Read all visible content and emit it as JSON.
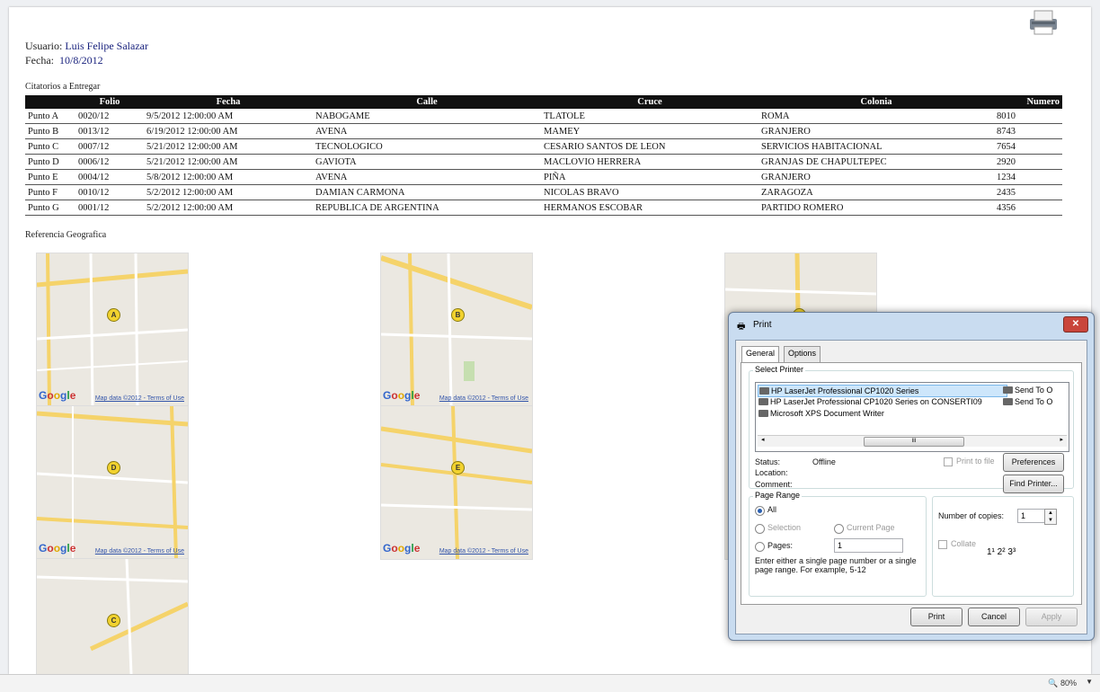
{
  "header": {
    "user_label": "Usuario:",
    "user_value": "Luis Felipe Salazar",
    "date_label": "Fecha:",
    "date_value": "10/8/2012"
  },
  "section_table_title": "Citatorios a Entregar",
  "table": {
    "columns": [
      "",
      "Folio",
      "Fecha",
      "Calle",
      "Cruce",
      "Colonia",
      "Numero"
    ],
    "rows": [
      [
        "Punto A",
        "0020/12",
        "9/5/2012 12:00:00 AM",
        "NABOGAME",
        "TLATOLE",
        "ROMA",
        "8010"
      ],
      [
        "Punto B",
        "0013/12",
        "6/19/2012 12:00:00 AM",
        "AVENA",
        "MAMEY",
        "GRANJERO",
        "8743"
      ],
      [
        "Punto C",
        "0007/12",
        "5/21/2012 12:00:00 AM",
        "TECNOLOGICO",
        "CESARIO SANTOS DE LEON",
        "SERVICIOS HABITACIONAL",
        "7654"
      ],
      [
        "Punto D",
        "0006/12",
        "5/21/2012 12:00:00 AM",
        "GAVIOTA",
        "MACLOVIO HERRERA",
        "GRANJAS DE CHAPULTEPEC",
        "2920"
      ],
      [
        "Punto E",
        "0004/12",
        "5/8/2012 12:00:00 AM",
        "AVENA",
        "PIÑA",
        "GRANJERO",
        "1234"
      ],
      [
        "Punto F",
        "0010/12",
        "5/2/2012 12:00:00 AM",
        "DAMIAN CARMONA",
        "NICOLAS BRAVO",
        "ZARAGOZA",
        "2435"
      ],
      [
        "Punto G",
        "0001/12",
        "5/2/2012 12:00:00 AM",
        "REPUBLICA DE ARGENTINA",
        "HERMANOS ESCOBAR",
        "PARTIDO ROMERO",
        "4356"
      ]
    ]
  },
  "section_maps_title": "Referencia Geografica",
  "maps": {
    "google": "Google",
    "map_data": "Map data ©2012 - Terms of Use",
    "markers": [
      "A",
      "D",
      "C",
      "B",
      "E",
      "F"
    ]
  },
  "print_dialog": {
    "title": "Print",
    "tabs": [
      "General",
      "Options"
    ],
    "select_printer_label": "Select Printer",
    "printers": [
      "HP LaserJet Professional CP1020 Series",
      "HP LaserJet Professional CP1020 Series on CONSERTI09",
      "Microsoft XPS Document Writer",
      "Send To O",
      "Send To O"
    ],
    "status_label": "Status:",
    "status_value": "Offline",
    "location_label": "Location:",
    "comment_label": "Comment:",
    "print_to_file": "Print to file",
    "preferences": "Preferences",
    "find_printer": "Find Printer...",
    "page_range_label": "Page Range",
    "all": "All",
    "selection": "Selection",
    "current_page": "Current Page",
    "pages": "Pages:",
    "pages_value": "1",
    "hint": "Enter either a single page number or a single page range.  For example, 5-12",
    "copies_label": "Number of copies:",
    "copies_value": "1",
    "collate": "Collate",
    "print_btn": "Print",
    "cancel_btn": "Cancel",
    "apply_btn": "Apply",
    "scroll_mark": "III"
  },
  "statusbar": {
    "zoom": "80%"
  }
}
